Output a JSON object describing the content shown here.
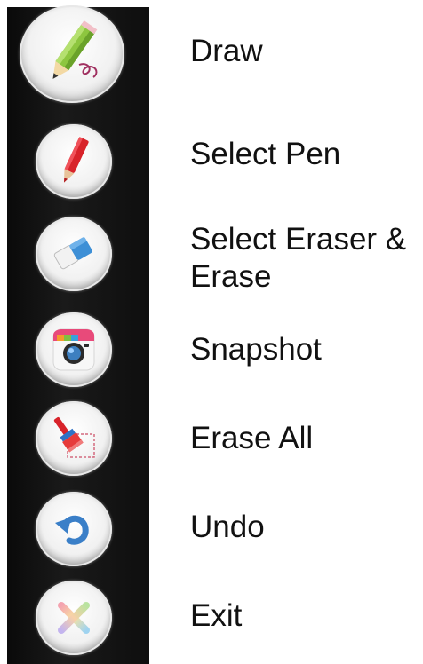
{
  "toolbar": {
    "items": [
      {
        "label": "Draw",
        "icon": "pencil-icon"
      },
      {
        "label": "Select Pen",
        "icon": "red-pen-icon"
      },
      {
        "label": "Select Eraser &",
        "label2": "Erase",
        "icon": "eraser-icon"
      },
      {
        "label": "Snapshot",
        "icon": "camera-icon"
      },
      {
        "label": "Erase All",
        "icon": "brush-icon"
      },
      {
        "label": "Undo",
        "icon": "undo-icon"
      },
      {
        "label": "Exit",
        "icon": "close-icon"
      }
    ]
  }
}
